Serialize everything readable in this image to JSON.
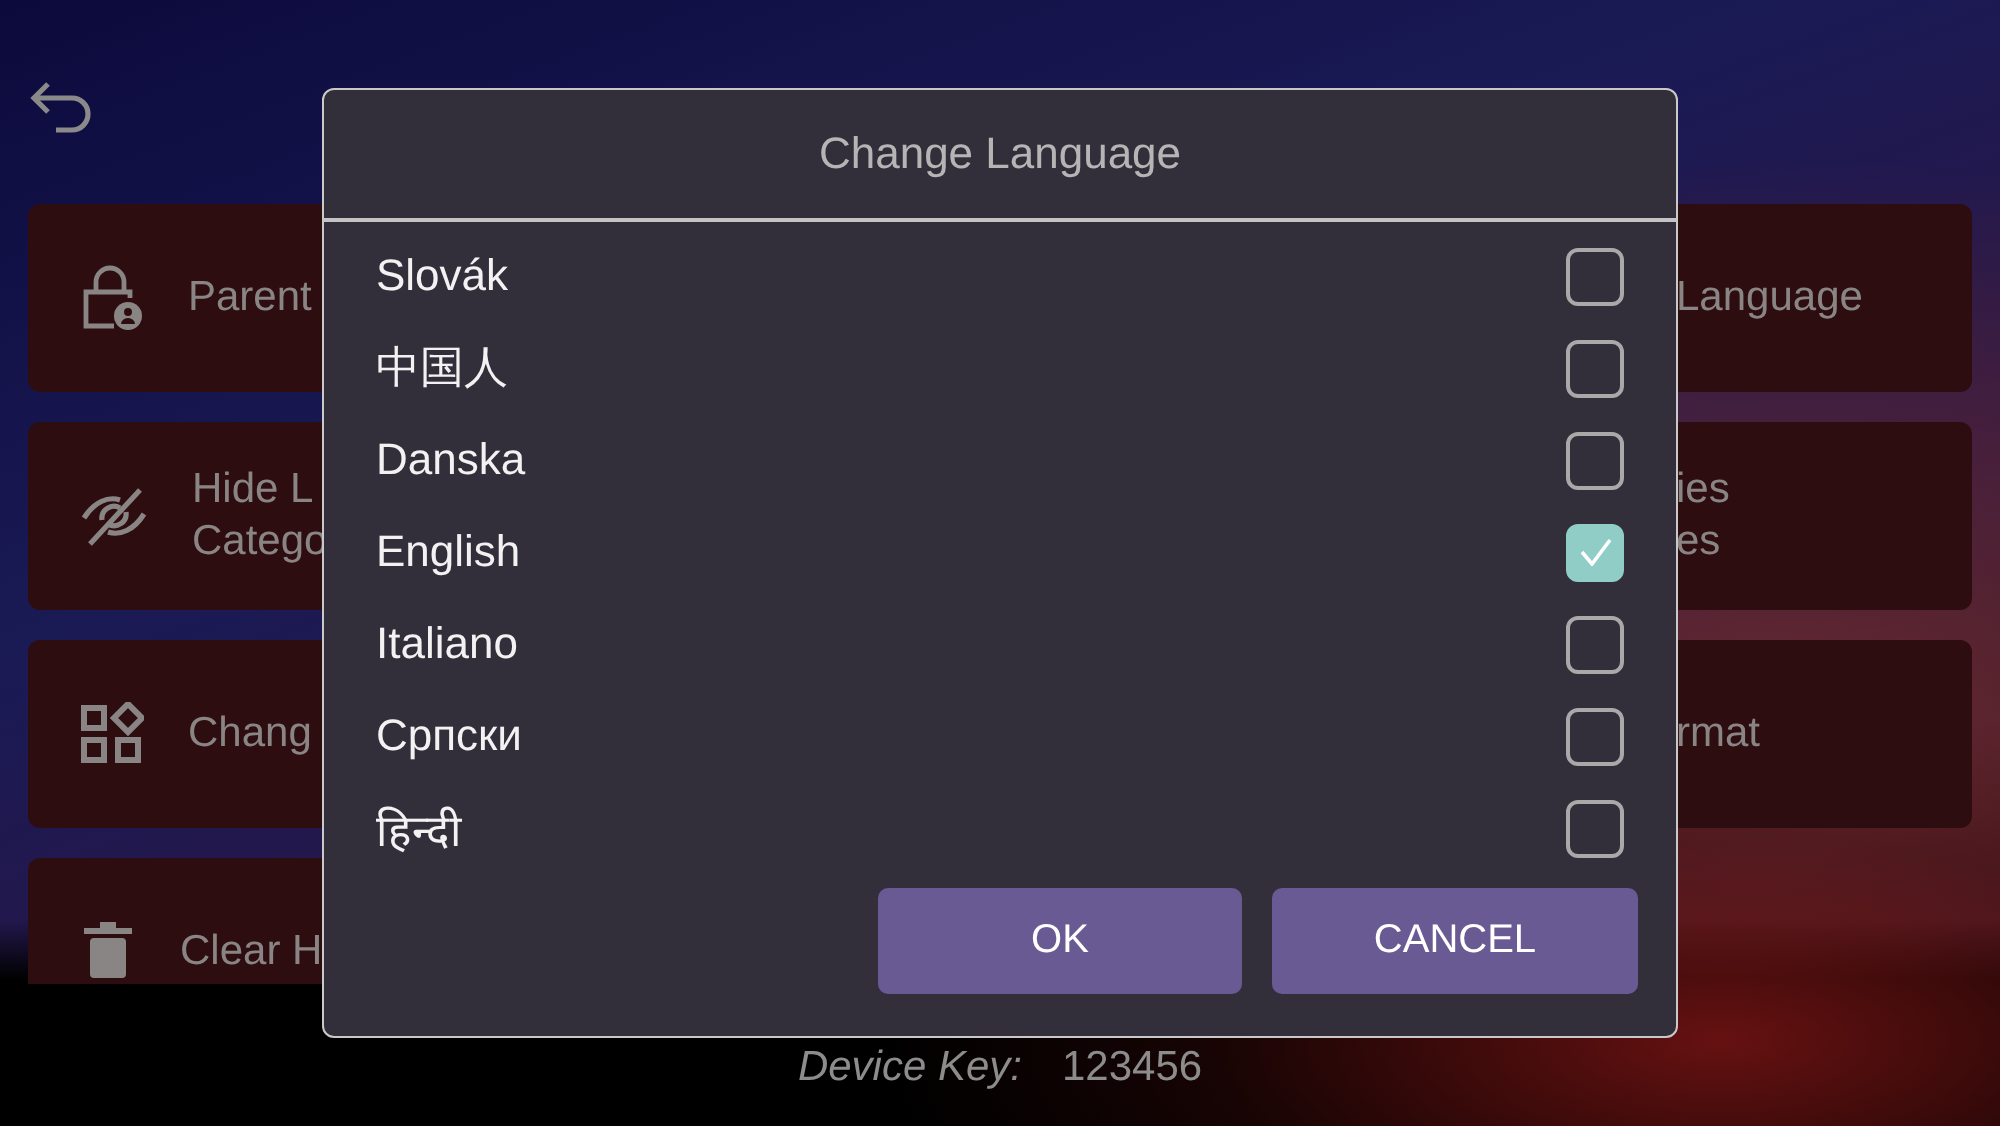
{
  "background_cards": {
    "left": [
      {
        "lines": [
          "Parent"
        ]
      },
      {
        "lines": [
          "Hide L",
          "Catego"
        ]
      },
      {
        "lines": [
          "Chang"
        ]
      },
      {
        "lines": [
          "Clear H"
        ]
      }
    ],
    "right": [
      {
        "lines": [
          "Language"
        ]
      },
      {
        "lines": [
          "ies",
          "es"
        ]
      },
      {
        "lines": [
          "rmat"
        ]
      }
    ]
  },
  "dialog": {
    "title": "Change Language",
    "languages": [
      {
        "label": "Slovák",
        "checked": false
      },
      {
        "label": "中国人",
        "checked": false
      },
      {
        "label": "Danska",
        "checked": false
      },
      {
        "label": "English",
        "checked": true
      },
      {
        "label": "Italiano",
        "checked": false
      },
      {
        "label": "Српски",
        "checked": false
      },
      {
        "label": "हिन्दी",
        "checked": false
      }
    ],
    "buttons": [
      "OK",
      "CANCEL"
    ]
  },
  "device_key": {
    "label": "Device Key:",
    "value": "123456"
  }
}
